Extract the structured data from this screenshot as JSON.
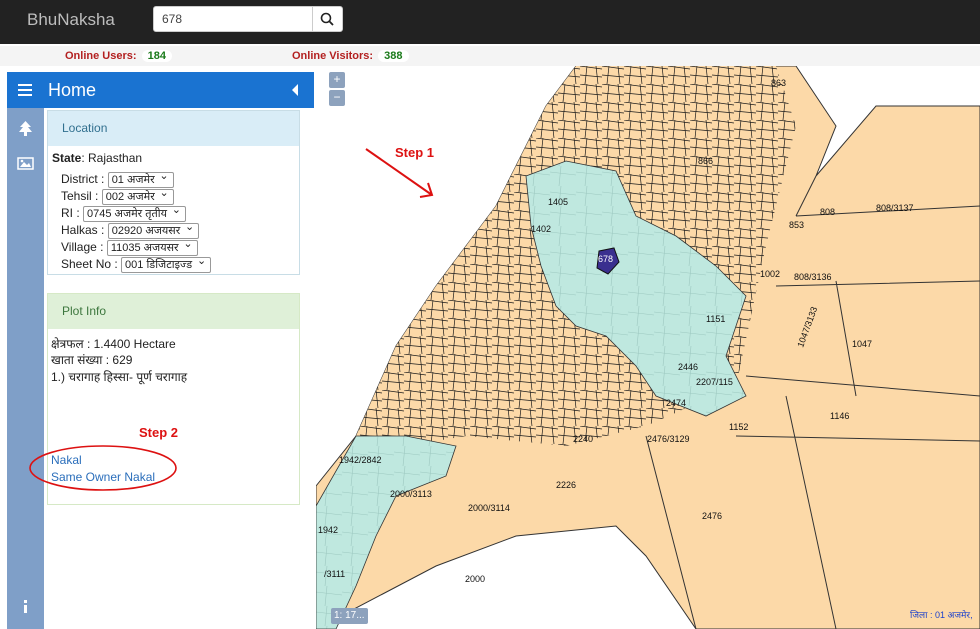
{
  "app": {
    "brand": "BhuNaksha"
  },
  "search": {
    "value": "678",
    "icon": "search-icon"
  },
  "stats": {
    "online_users_label": "Online Users:",
    "online_users": "184",
    "online_visitors_label": "Online Visitors:",
    "online_visitors": "388"
  },
  "sidebar": {
    "title": "Home",
    "icons": [
      "menu-icon",
      "tree-icon",
      "image-icon",
      "info-icon"
    ]
  },
  "location": {
    "title": "Location",
    "state_label": "State",
    "state_value": ": Rajasthan",
    "fields": [
      {
        "label": "District :",
        "value": "01 अजमेर"
      },
      {
        "label": "Tehsil :",
        "value": "002 अजमेर"
      },
      {
        "label": "RI :",
        "value": "0745 अजमेर तृतीय"
      },
      {
        "label": "Halkas :",
        "value": "02920 अजयसर"
      },
      {
        "label": "Village :",
        "value": "11035 अजयसर"
      },
      {
        "label": "Sheet No :",
        "value": "001 डिजिटाइज्ड"
      }
    ]
  },
  "plot": {
    "title": "Plot Info",
    "area": "क्षेत्रफल : 1.4400 Hectare",
    "khata": "खाता संख्या : 629",
    "owner": "1.) चरागाह हिस्सा- पूर्ण चरागाह",
    "links": [
      "Nakal",
      "Same Owner Nakal"
    ]
  },
  "annotations": {
    "step1": "Step 1",
    "step2": "Step 2"
  },
  "map": {
    "zoom_in": "+",
    "zoom_out": "−",
    "scale": "1: 17...",
    "footer": "जिला : 01 अजमेर,",
    "labels": [
      "1405",
      "1402",
      "678",
      "853",
      "808",
      "808/3137",
      "1002",
      "808/3136",
      "1047/3133",
      "1047",
      "1146",
      "1152",
      "2446",
      "2207/115",
      "2474",
      "2240",
      "2476/3129",
      "1942/2842",
      "2000/3113",
      "2226",
      "2000/3114",
      "2476",
      "2000",
      "/3111",
      "1942",
      "863",
      "866",
      "1151"
    ],
    "colors": {
      "parcel": "#fcd9a8",
      "pasture": "#bfe8df",
      "selected": "#3a2f8f",
      "line": "#1a1a1a"
    }
  }
}
